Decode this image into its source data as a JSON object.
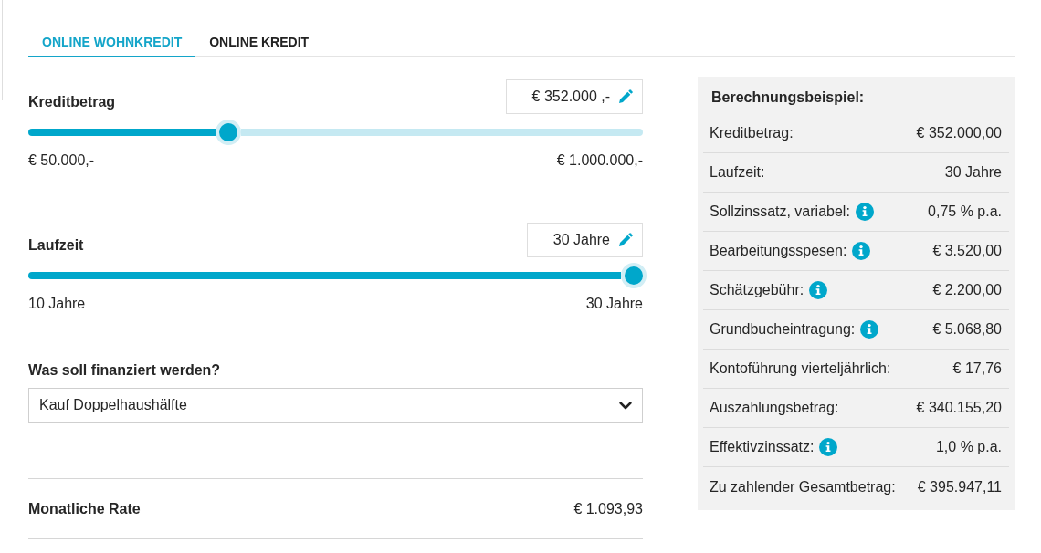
{
  "tabs": [
    {
      "label": "ONLINE WOHNKREDIT",
      "selected": true
    },
    {
      "label": "ONLINE KREDIT",
      "selected": false
    }
  ],
  "sliders": [
    {
      "label": "Kreditbetrag",
      "value": "€ 352.000 ,-",
      "level": 0.32,
      "min_label": "€ 50.000,-",
      "max_label": "€ 1.000.000,-"
    },
    {
      "label": "Laufzeit",
      "value": "30 Jahre",
      "level": 1,
      "min_label": "10 Jahre",
      "max_label": "30 Jahre"
    }
  ],
  "purpose": {
    "label": "Was soll finanziert werden?",
    "value": "Kauf Doppelhaushälfte"
  },
  "monthly_rate": {
    "label": "Monatliche Rate",
    "value": "€ 1.093,93"
  },
  "example": {
    "title": "Berechnungsbeispiel:",
    "rows": [
      {
        "label": "Kreditbetrag:",
        "value": "€ 352.000,00",
        "info": false
      },
      {
        "label": "Laufzeit:",
        "value": "30 Jahre",
        "info": false
      },
      {
        "label": "Sollzinssatz, variabel:",
        "value": "0,75 % p.a.",
        "info": true
      },
      {
        "label": "Bearbeitungsspesen:",
        "value": "€ 3.520,00",
        "info": true
      },
      {
        "label": "Schätzgebühr:",
        "value": "€ 2.200,00",
        "info": true
      },
      {
        "label": "Grundbucheintragung:",
        "value": "€ 5.068,80",
        "info": true
      },
      {
        "label": "Kontoführung vierteljährlich:",
        "value": "€ 17,76",
        "info": false
      },
      {
        "label": "Auszahlungsbetrag:",
        "value": "€ 340.155,20",
        "info": false
      },
      {
        "label": "Effektivzinssatz:",
        "value": "1,0 % p.a.",
        "info": true
      },
      {
        "label": "Zu zahlender Gesamtbetrag:",
        "value": "€ 395.947,11",
        "info": false
      }
    ]
  }
}
